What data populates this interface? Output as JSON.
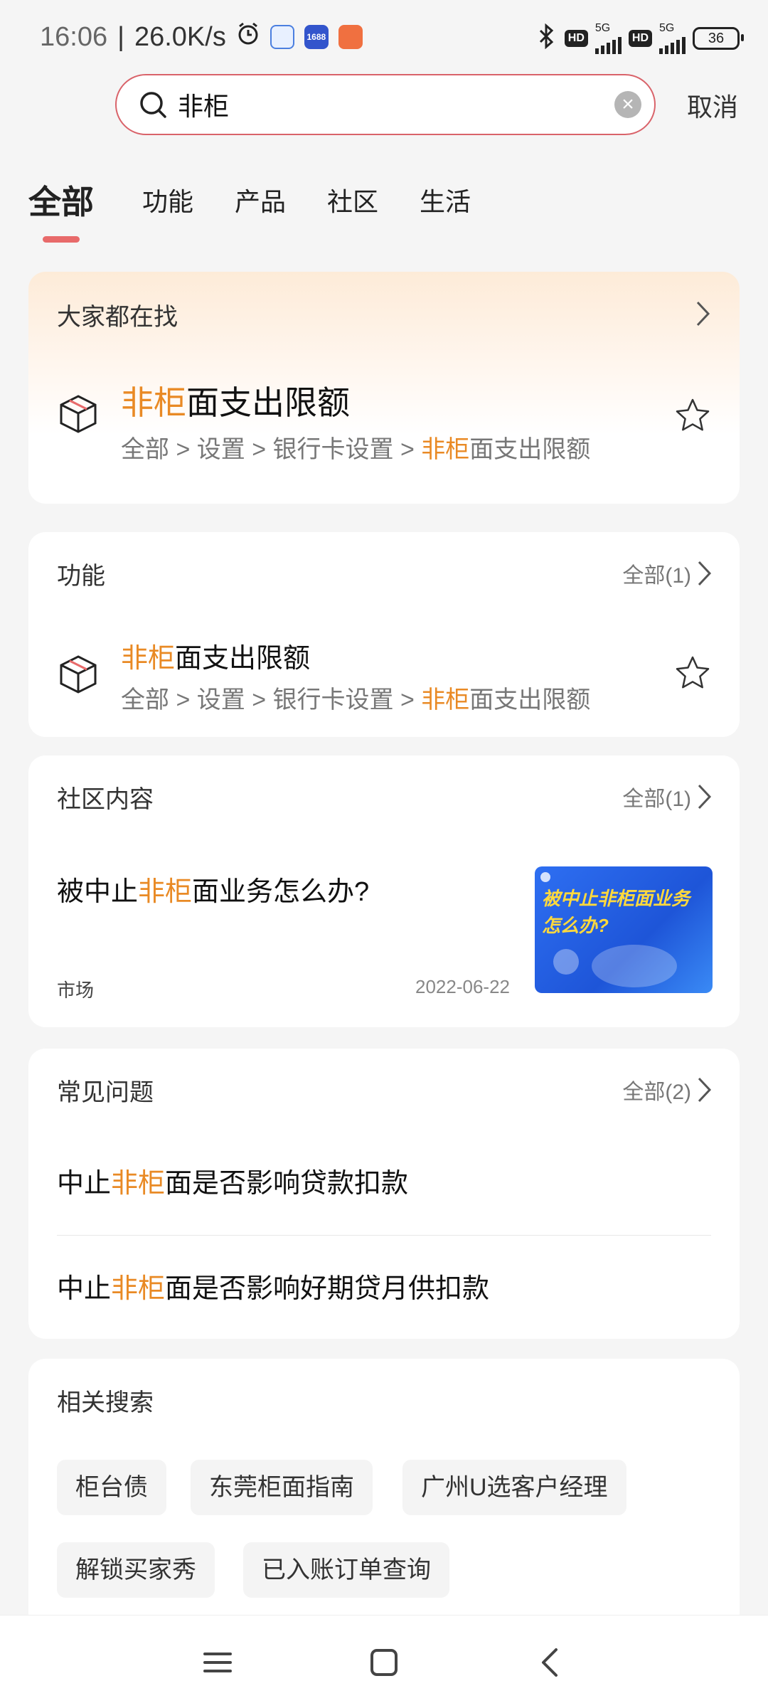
{
  "status_bar": {
    "time": "16:06",
    "net_speed": "26.0K/s",
    "app_icon_1": "1688",
    "hd1": "HD",
    "net1": "5G",
    "hd2": "HD",
    "net2": "5G",
    "battery": "36"
  },
  "search": {
    "value": "非柜",
    "cancel_label": "取消"
  },
  "tabs": [
    {
      "label": "全部",
      "active": true
    },
    {
      "label": "功能"
    },
    {
      "label": "产品"
    },
    {
      "label": "社区"
    },
    {
      "label": "生活"
    }
  ],
  "hot": {
    "header": "大家都在找",
    "item": {
      "title_hl": "非柜",
      "title_rest": "面支出限额",
      "path_prefix": "全部 > 设置 > 银行卡设置 > ",
      "path_hl": "非柜",
      "path_rest": "面支出限额"
    }
  },
  "functions": {
    "header": "功能",
    "more": "全部(1)",
    "item": {
      "title_hl": "非柜",
      "title_rest": "面支出限额",
      "path_prefix": "全部 > 设置 > 银行卡设置 > ",
      "path_hl": "非柜",
      "path_rest": "面支出限额"
    }
  },
  "community": {
    "header": "社区内容",
    "more": "全部(1)",
    "post": {
      "title_pre": "被中止",
      "title_hl": "非柜",
      "title_rest": "面业务怎么办?",
      "tag": "市场",
      "date": "2022-06-22",
      "thumb_text_1": "被中止非柜面业务",
      "thumb_text_2": "怎么办?"
    }
  },
  "faq": {
    "header": "常见问题",
    "more": "全部(2)",
    "items": [
      {
        "pre": "中止",
        "hl": "非柜",
        "rest": "面是否影响贷款扣款"
      },
      {
        "pre": "中止",
        "hl": "非柜",
        "rest": "面是否影响好期贷月供扣款"
      }
    ]
  },
  "related": {
    "header": "相关搜索",
    "chips": [
      "柜台债",
      "东莞柜面指南",
      "广州U选客户经理",
      "解锁买家秀",
      "已入账订单查询"
    ]
  },
  "colors": {
    "highlight": "#e98a25",
    "accent": "#e86a6a",
    "search_border": "#d9636a"
  }
}
